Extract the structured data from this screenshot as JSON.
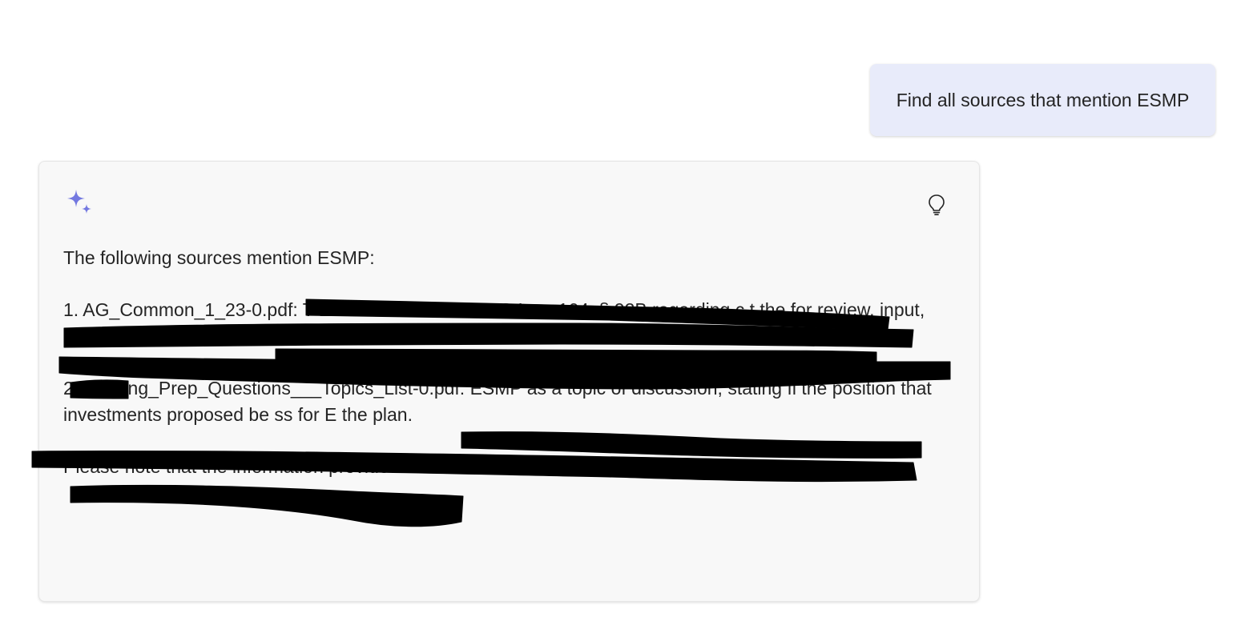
{
  "user_message": {
    "text": "Find all sources that mention ESMP"
  },
  "response": {
    "icons": {
      "assistant": "sparkle-icon",
      "action": "lightbulb-icon"
    },
    "accent_color": "#7378e0",
    "intro": "The following sources mention ESMP:",
    "sources": [
      {
        "text": "1. AG_Common_1_23-0.pdf: T                           ESMP in reference to G.L. c. 164, § 92B regarding c                                                                                                          t                                                                                                                    the for review, input, and                                                                                            tember 1"
      },
      {
        "text": "2. Hearing_Prep_Questions___Topics_List-0.pdf:                           ESMP as a topic of discussion, stating                 fi               the position that investments proposed                                      be ss for E                                 the                 plan."
      }
    ],
    "closing": "Please note that the information provided is based on the sources listed."
  }
}
